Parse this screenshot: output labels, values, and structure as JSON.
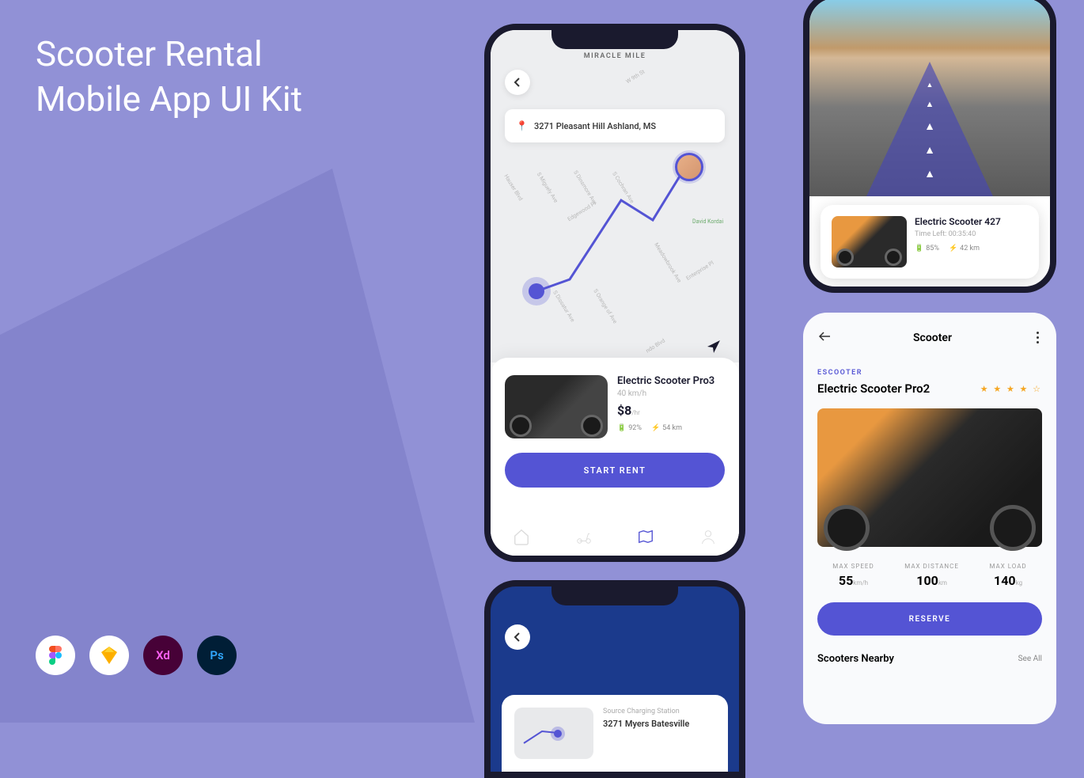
{
  "header": {
    "title_line1": "Scooter Rental",
    "title_line2": "Mobile App UI Kit"
  },
  "tools": [
    "Fig",
    "Sk",
    "Xd",
    "Ps"
  ],
  "phone1": {
    "map_label": "MIRACLE MILE",
    "address": "3271 Pleasant Hill Ashland, MS",
    "streets": [
      "W 9th St",
      "Hauser Blvd",
      "S Miguely Ave",
      "S Dinsmore Ave",
      "S Cochran Ave",
      "Edgewood Pl",
      "Meadowbrook Ave",
      "S Dissatur Ave",
      "S Orange of Ave",
      "Enterprise Pl",
      "ndo Blvd",
      "David Kordai"
    ],
    "scooter_name": "Electric Scooter Pro3",
    "speed": "40 km/h",
    "price": "$8",
    "price_unit": "/hr",
    "battery": "92%",
    "distance": "54 km",
    "start_btn": "START RENT"
  },
  "phone2": {
    "scooter_name": "Electric Scooter 427",
    "time_left_label": "Time Left:",
    "time_left": "00:35:40",
    "battery": "85%",
    "distance": "42 km"
  },
  "phone3": {
    "page_title": "Scooter",
    "category": "ESCOOTER",
    "name": "Electric Scooter Pro2",
    "specs": [
      {
        "label": "MAX SPEED",
        "value": "55",
        "unit": "km/h"
      },
      {
        "label": "MAX DISTANCE",
        "value": "100",
        "unit": "km"
      },
      {
        "label": "MAX LOAD",
        "value": "140",
        "unit": "kg"
      }
    ],
    "reserve_btn": "RESERVE",
    "nearby_title": "Scooters Nearby",
    "see_all": "See All"
  },
  "phone4": {
    "source_label": "Source Charging Station",
    "address": "3271 Myers Batesville"
  }
}
